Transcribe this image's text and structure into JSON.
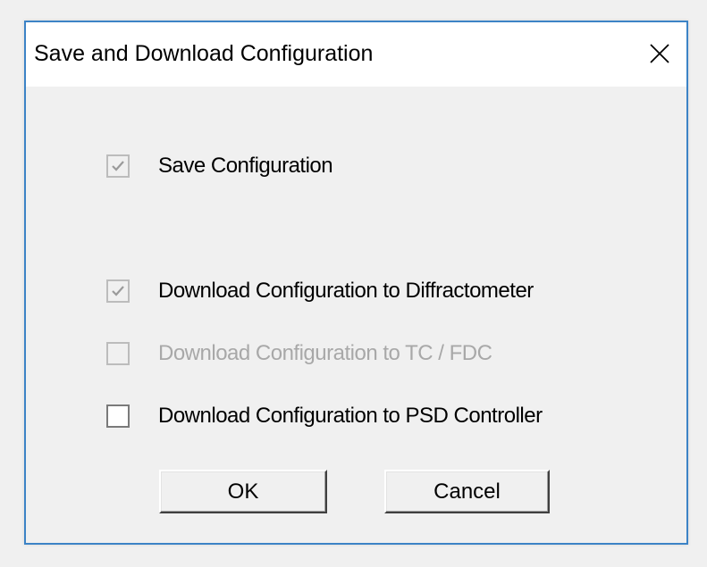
{
  "window": {
    "title": "Save and Download Configuration",
    "close_glyph": "X",
    "accent_color": "#3c83c6"
  },
  "options": [
    {
      "id": "save",
      "label": "Save Configuration",
      "checked": true,
      "enabled": false
    },
    {
      "id": "diffractometer",
      "label": "Download Configuration to Diffractometer",
      "checked": true,
      "enabled": false
    },
    {
      "id": "tc_fdc",
      "label": "Download Configuration to TC / FDC",
      "checked": false,
      "enabled": false
    },
    {
      "id": "psd",
      "label": "Download Configuration to PSD Controller",
      "checked": false,
      "enabled": true
    }
  ],
  "buttons": {
    "ok_label": "OK",
    "cancel_label": "Cancel"
  }
}
